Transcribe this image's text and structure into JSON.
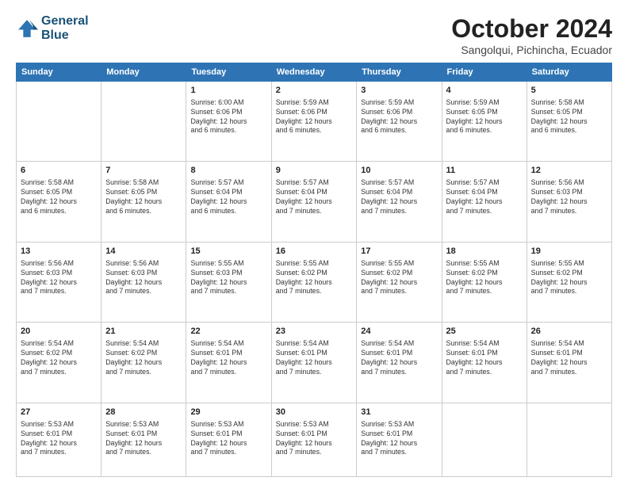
{
  "logo": {
    "line1": "General",
    "line2": "Blue"
  },
  "header": {
    "month": "October 2024",
    "location": "Sangolqui, Pichincha, Ecuador"
  },
  "weekdays": [
    "Sunday",
    "Monday",
    "Tuesday",
    "Wednesday",
    "Thursday",
    "Friday",
    "Saturday"
  ],
  "weeks": [
    [
      {
        "day": "",
        "info": ""
      },
      {
        "day": "",
        "info": ""
      },
      {
        "day": "1",
        "info": "Sunrise: 6:00 AM\nSunset: 6:06 PM\nDaylight: 12 hours\nand 6 minutes."
      },
      {
        "day": "2",
        "info": "Sunrise: 5:59 AM\nSunset: 6:06 PM\nDaylight: 12 hours\nand 6 minutes."
      },
      {
        "day": "3",
        "info": "Sunrise: 5:59 AM\nSunset: 6:06 PM\nDaylight: 12 hours\nand 6 minutes."
      },
      {
        "day": "4",
        "info": "Sunrise: 5:59 AM\nSunset: 6:05 PM\nDaylight: 12 hours\nand 6 minutes."
      },
      {
        "day": "5",
        "info": "Sunrise: 5:58 AM\nSunset: 6:05 PM\nDaylight: 12 hours\nand 6 minutes."
      }
    ],
    [
      {
        "day": "6",
        "info": "Sunrise: 5:58 AM\nSunset: 6:05 PM\nDaylight: 12 hours\nand 6 minutes."
      },
      {
        "day": "7",
        "info": "Sunrise: 5:58 AM\nSunset: 6:05 PM\nDaylight: 12 hours\nand 6 minutes."
      },
      {
        "day": "8",
        "info": "Sunrise: 5:57 AM\nSunset: 6:04 PM\nDaylight: 12 hours\nand 6 minutes."
      },
      {
        "day": "9",
        "info": "Sunrise: 5:57 AM\nSunset: 6:04 PM\nDaylight: 12 hours\nand 7 minutes."
      },
      {
        "day": "10",
        "info": "Sunrise: 5:57 AM\nSunset: 6:04 PM\nDaylight: 12 hours\nand 7 minutes."
      },
      {
        "day": "11",
        "info": "Sunrise: 5:57 AM\nSunset: 6:04 PM\nDaylight: 12 hours\nand 7 minutes."
      },
      {
        "day": "12",
        "info": "Sunrise: 5:56 AM\nSunset: 6:03 PM\nDaylight: 12 hours\nand 7 minutes."
      }
    ],
    [
      {
        "day": "13",
        "info": "Sunrise: 5:56 AM\nSunset: 6:03 PM\nDaylight: 12 hours\nand 7 minutes."
      },
      {
        "day": "14",
        "info": "Sunrise: 5:56 AM\nSunset: 6:03 PM\nDaylight: 12 hours\nand 7 minutes."
      },
      {
        "day": "15",
        "info": "Sunrise: 5:55 AM\nSunset: 6:03 PM\nDaylight: 12 hours\nand 7 minutes."
      },
      {
        "day": "16",
        "info": "Sunrise: 5:55 AM\nSunset: 6:02 PM\nDaylight: 12 hours\nand 7 minutes."
      },
      {
        "day": "17",
        "info": "Sunrise: 5:55 AM\nSunset: 6:02 PM\nDaylight: 12 hours\nand 7 minutes."
      },
      {
        "day": "18",
        "info": "Sunrise: 5:55 AM\nSunset: 6:02 PM\nDaylight: 12 hours\nand 7 minutes."
      },
      {
        "day": "19",
        "info": "Sunrise: 5:55 AM\nSunset: 6:02 PM\nDaylight: 12 hours\nand 7 minutes."
      }
    ],
    [
      {
        "day": "20",
        "info": "Sunrise: 5:54 AM\nSunset: 6:02 PM\nDaylight: 12 hours\nand 7 minutes."
      },
      {
        "day": "21",
        "info": "Sunrise: 5:54 AM\nSunset: 6:02 PM\nDaylight: 12 hours\nand 7 minutes."
      },
      {
        "day": "22",
        "info": "Sunrise: 5:54 AM\nSunset: 6:01 PM\nDaylight: 12 hours\nand 7 minutes."
      },
      {
        "day": "23",
        "info": "Sunrise: 5:54 AM\nSunset: 6:01 PM\nDaylight: 12 hours\nand 7 minutes."
      },
      {
        "day": "24",
        "info": "Sunrise: 5:54 AM\nSunset: 6:01 PM\nDaylight: 12 hours\nand 7 minutes."
      },
      {
        "day": "25",
        "info": "Sunrise: 5:54 AM\nSunset: 6:01 PM\nDaylight: 12 hours\nand 7 minutes."
      },
      {
        "day": "26",
        "info": "Sunrise: 5:54 AM\nSunset: 6:01 PM\nDaylight: 12 hours\nand 7 minutes."
      }
    ],
    [
      {
        "day": "27",
        "info": "Sunrise: 5:53 AM\nSunset: 6:01 PM\nDaylight: 12 hours\nand 7 minutes."
      },
      {
        "day": "28",
        "info": "Sunrise: 5:53 AM\nSunset: 6:01 PM\nDaylight: 12 hours\nand 7 minutes."
      },
      {
        "day": "29",
        "info": "Sunrise: 5:53 AM\nSunset: 6:01 PM\nDaylight: 12 hours\nand 7 minutes."
      },
      {
        "day": "30",
        "info": "Sunrise: 5:53 AM\nSunset: 6:01 PM\nDaylight: 12 hours\nand 7 minutes."
      },
      {
        "day": "31",
        "info": "Sunrise: 5:53 AM\nSunset: 6:01 PM\nDaylight: 12 hours\nand 7 minutes."
      },
      {
        "day": "",
        "info": ""
      },
      {
        "day": "",
        "info": ""
      }
    ]
  ]
}
